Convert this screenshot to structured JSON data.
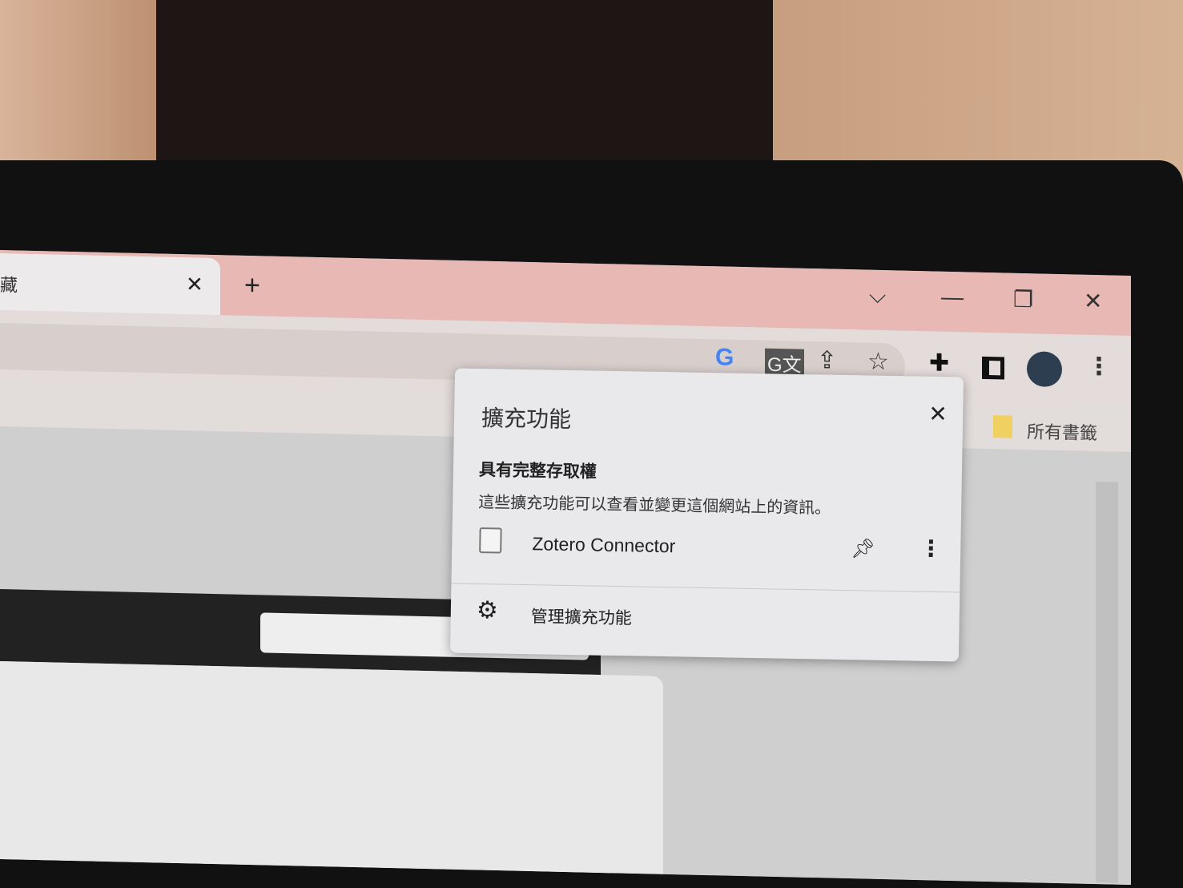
{
  "browser": {
    "tab": {
      "title_fragment": "藏",
      "close_icon": "close-icon"
    },
    "new_tab_icon": "plus-icon",
    "window_controls": {
      "tab_search": "⌵",
      "minimize": "—",
      "restore": "❐",
      "close": "✕"
    },
    "toolbar_icons": [
      "google-icon",
      "translate-icon",
      "share-icon",
      "star-icon",
      "extensions-icon",
      "side-panel-icon",
      "profile-icon",
      "more-icon"
    ],
    "bookmarks": {
      "all_bookmarks": "所有書籤"
    }
  },
  "extensions_popup": {
    "title": "擴充功能",
    "section_heading": "具有完整存取權",
    "section_description": "這些擴充功能可以查看並變更這個網站上的資訊。",
    "items": [
      {
        "name": "Zotero Connector"
      }
    ],
    "manage_label": "管理擴充功能"
  },
  "colors": {
    "tabstrip": "#e7b8b4",
    "popup_bg": "#e9e9ec"
  }
}
